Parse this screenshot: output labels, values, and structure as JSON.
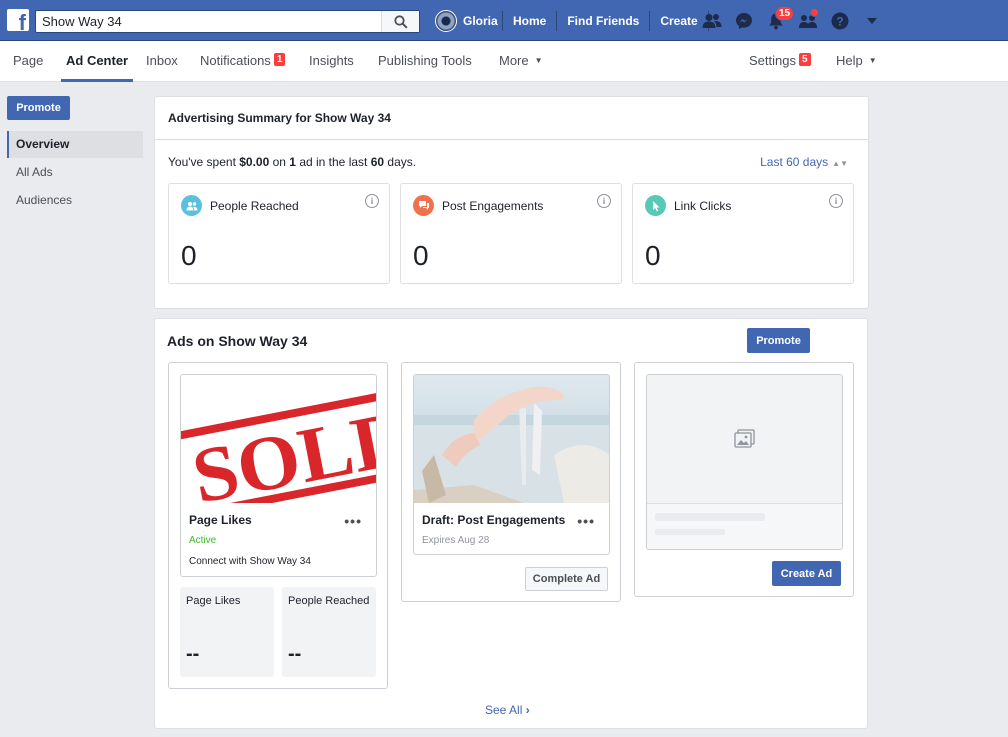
{
  "topbar": {
    "search_value": "Show Way 34",
    "user_name": "Gloria",
    "links": [
      "Home",
      "Find Friends",
      "Create"
    ],
    "notifications_count": "15"
  },
  "pagenav": {
    "items": [
      {
        "label": "Page"
      },
      {
        "label": "Ad Center"
      },
      {
        "label": "Inbox"
      },
      {
        "label": "Notifications",
        "badge": "1"
      },
      {
        "label": "Insights"
      },
      {
        "label": "Publishing Tools"
      },
      {
        "label": "More"
      }
    ],
    "settings": {
      "label": "Settings",
      "badge": "5"
    },
    "help": "Help"
  },
  "sidebar": {
    "promote_label": "Promote",
    "items": [
      "Overview",
      "All Ads",
      "Audiences"
    ]
  },
  "summary": {
    "title": "Advertising Summary for Show Way 34",
    "spent_prefix": "You've spent ",
    "spent_amount": "$0.00",
    "spent_mid": " on ",
    "ad_count": "1",
    "spent_mid2": " ad in the last ",
    "days": "60",
    "spent_suffix": " days.",
    "range_label": "Last 60 days",
    "metrics": [
      {
        "label": "People Reached",
        "value": "0",
        "color": "#5bc0de"
      },
      {
        "label": "Post Engagements",
        "value": "0",
        "color": "#f0714f"
      },
      {
        "label": "Link Clicks",
        "value": "0",
        "color": "#57c9b6"
      }
    ]
  },
  "ads": {
    "title": "Ads on Show Way 34",
    "promote_label": "Promote",
    "cards": [
      {
        "title": "Page Likes",
        "status": "Active",
        "subtitle": "Connect with Show Way 34",
        "image_text": "SOLD",
        "stats": [
          {
            "label": "Page Likes",
            "value": "--"
          },
          {
            "label": "People Reached",
            "value": "--"
          }
        ]
      },
      {
        "title": "Draft: Post Engagements",
        "expires": "Expires Aug 28",
        "button": "Complete Ad"
      },
      {
        "button": "Create Ad"
      }
    ],
    "see_all": "See All"
  },
  "colors": {
    "brand": "#4267b2",
    "badge": "#fa3e3e",
    "active_status": "#42b72a"
  }
}
